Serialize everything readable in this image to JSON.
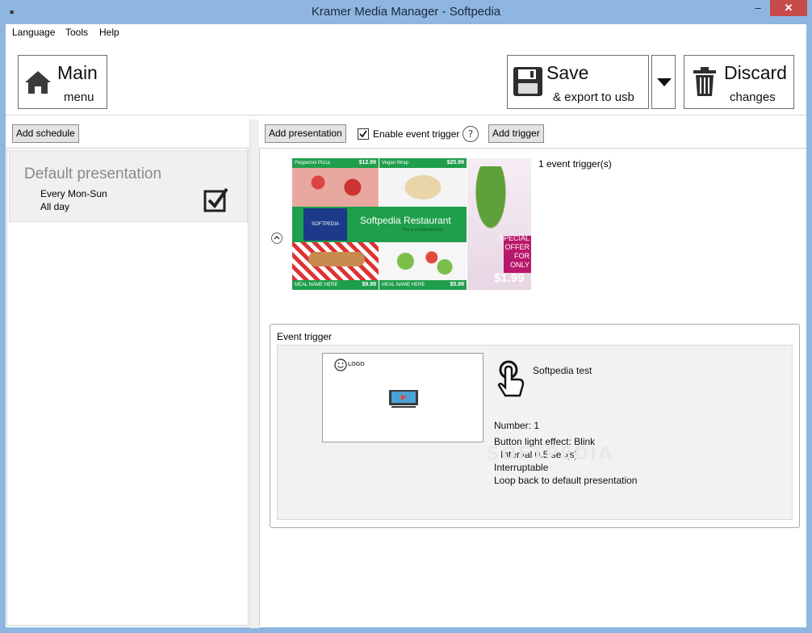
{
  "window": {
    "title": "Kramer Media Manager - Softpedia",
    "min_glyph": "–",
    "max_glyph": "□",
    "close_glyph": "✕"
  },
  "menubar": {
    "items": [
      "Language",
      "Tools",
      "Help"
    ]
  },
  "toolbar": {
    "main": {
      "line1": "Main",
      "line2": "menu"
    },
    "save": {
      "line1": "Save",
      "line2": "& export to usb"
    },
    "discard": {
      "line1": "Discard",
      "line2": "changes"
    }
  },
  "left": {
    "add_schedule": "Add schedule",
    "schedule": {
      "title": "Default presentation",
      "days": "Every Mon-Sun",
      "time": "All day"
    }
  },
  "right": {
    "add_presentation": "Add presentation",
    "enable_event_trigger": "Enable event trigger",
    "enable_event_trigger_checked": true,
    "help": "?",
    "add_trigger": "Add trigger",
    "trigger_count": "1 event trigger(s)",
    "thumbnail": {
      "item1": "Pepperoni Pizza",
      "price1": "$12.99",
      "item2": "Vegan Wrap",
      "price2": "$25.99",
      "brand": "SOFTPEDIA",
      "restaurant": "Softpedia Restaurant",
      "subtitle": "This is a Softpedia test",
      "item3": "MEAL NAME HERE",
      "price3": "$9.99",
      "item4": "MEAL NAME HERE",
      "price4": "$5.99",
      "special": "SPECIAL OFFER FOR ONLY",
      "special_price": "$1.99"
    },
    "event_trigger": {
      "legend": "Event trigger",
      "logo": "LOGO",
      "name": "Softpedia test",
      "number": "Number: 1",
      "effect": "Button light effect: Blink",
      "interval": "Interval 0.5 sec(s)",
      "interruptable": "Interruptable",
      "loop": "Loop back to default presentation"
    }
  },
  "watermark": "SOFTPEDIA"
}
